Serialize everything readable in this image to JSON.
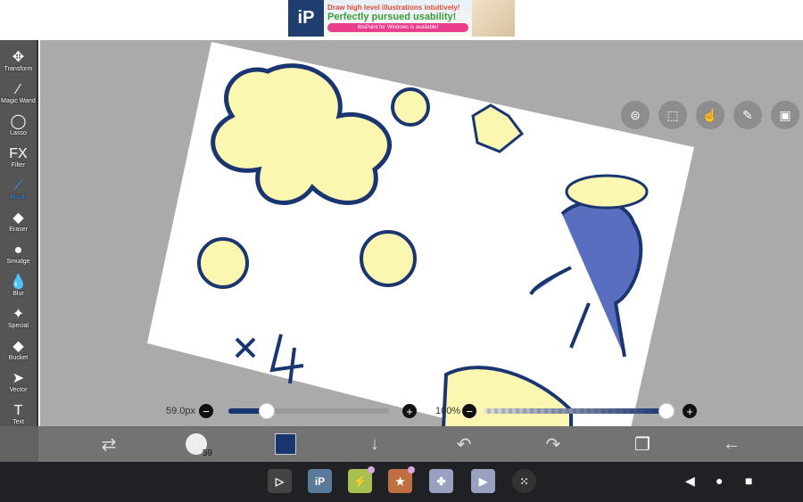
{
  "banner": {
    "logo": "iP",
    "line1": "Draw high level illustrations intuitively!",
    "line2": "Perfectly pursued usability!",
    "line3": "ibisPaint for Windows is available!"
  },
  "tools": [
    {
      "label": "Transform",
      "icon": "move-icon",
      "glyph": "✥"
    },
    {
      "label": "Magic Wand",
      "icon": "magic-wand-icon",
      "glyph": "⁄"
    },
    {
      "label": "Lasso",
      "icon": "lasso-icon",
      "glyph": "◯"
    },
    {
      "label": "Filter",
      "icon": "filter-icon",
      "glyph": "FX"
    },
    {
      "label": "Brush",
      "icon": "brush-icon",
      "glyph": "⟋",
      "active": true
    },
    {
      "label": "Eraser",
      "icon": "eraser-icon",
      "glyph": "◆"
    },
    {
      "label": "Smudge",
      "icon": "smudge-icon",
      "glyph": "●"
    },
    {
      "label": "Blur",
      "icon": "blur-icon",
      "glyph": "💧"
    },
    {
      "label": "Special",
      "icon": "special-icon",
      "glyph": "✦"
    },
    {
      "label": "Bucket",
      "icon": "bucket-icon",
      "glyph": "◆"
    },
    {
      "label": "Vector",
      "icon": "vector-icon",
      "glyph": "➤"
    },
    {
      "label": "Text",
      "icon": "text-icon",
      "glyph": "T"
    }
  ],
  "brush": {
    "size_label": "59.0px",
    "size_fraction": 0.24,
    "opacity_label": "100%",
    "opacity_fraction": 1.0,
    "size_badge": "59"
  },
  "colors": {
    "primary": "#1a3670",
    "canvas": "#ffffff",
    "accent": "#3a8ff0",
    "fill_yellow": "#fbf6b0",
    "fill_blue": "#5a6ec0"
  }
}
